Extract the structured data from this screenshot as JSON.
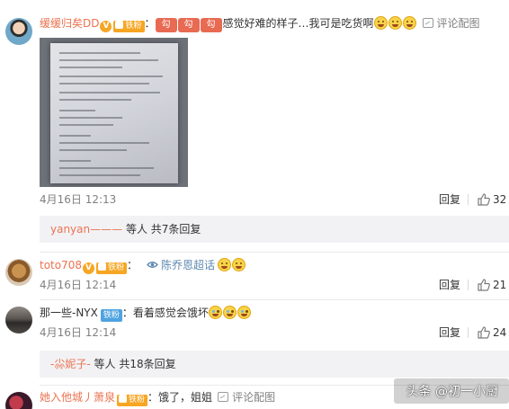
{
  "comments": [
    {
      "user": "缓缓归矣DD",
      "v_badge": "V",
      "fan_badge": "铁粉",
      "text_prefix": "：",
      "stickers": [
        "勾",
        "勾",
        "勾"
      ],
      "text": "感觉好难的样子…我可是吃货啊",
      "action_label": "评论配图",
      "date": "4月16日 12:13",
      "reply_label": "回复",
      "likes": "32",
      "sub_replies": {
        "user": "yanyan———",
        "suffix": "等人 共7条回复"
      }
    },
    {
      "user": "toto708",
      "v_badge": "V",
      "fan_badge": "铁粉",
      "text_prefix": "：",
      "link_text": "陈乔恩超话",
      "date": "4月16日 12:14",
      "reply_label": "回复",
      "likes": "21"
    },
    {
      "user": "那一些-NYX",
      "fan_badge": "铁粉",
      "text_prefix": "：",
      "text": "看着感觉会饿坏",
      "date": "4月16日 12:14",
      "reply_label": "回复",
      "likes": "24",
      "sub_replies": {
        "user": "-尛妮子-",
        "suffix": "等人 共18条回复"
      }
    },
    {
      "user": "她入他城丿萧泉",
      "fan_badge": "铁粉",
      "text_prefix": "：",
      "text": "饿了，姐姐",
      "action_label": "评论配图"
    }
  ],
  "watermark": "头条 @初一小厨",
  "colors": {
    "username": "#eb7350",
    "fan_badge": "#f6a623",
    "sub_box": "#f2f2f5",
    "link": "#5d88b0"
  }
}
